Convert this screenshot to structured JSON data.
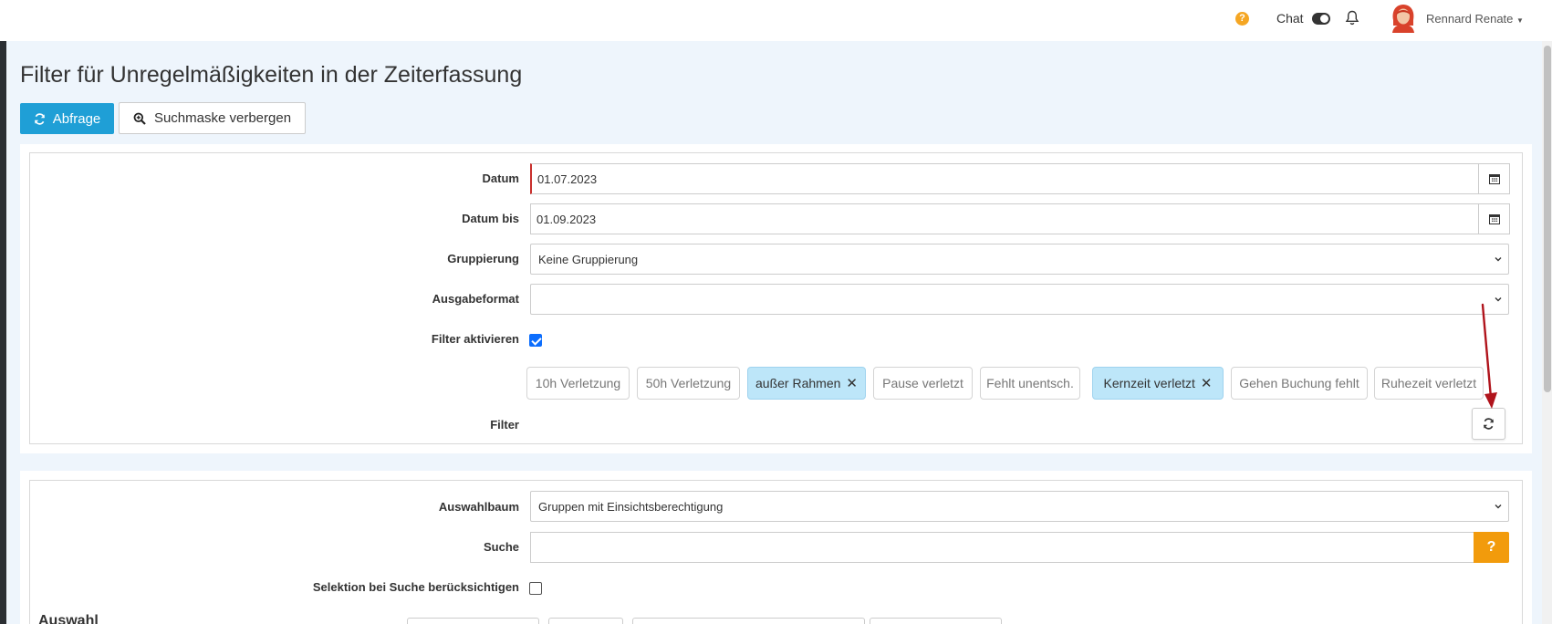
{
  "topbar": {
    "help_label": "?",
    "chat_label": "Chat",
    "user_name": "Rennard Renate"
  },
  "page": {
    "title": "Filter für Unregelmäßigkeiten in der Zeiterfassung"
  },
  "toolbar": {
    "query_label": "Abfrage",
    "hide_search_label": "Suchmaske verbergen"
  },
  "filter_form": {
    "date_label": "Datum",
    "date_value": "01.07.2023",
    "date_to_label": "Datum bis",
    "date_to_value": "01.09.2023",
    "grouping_label": "Gruppierung",
    "grouping_value": "Keine Gruppierung",
    "output_label": "Ausgabeformat",
    "output_value": "",
    "activate_label": "Filter aktivieren",
    "activate_checked": true,
    "filter_label": "Filter",
    "chips": [
      {
        "label": "10h Verletzung",
        "active": false
      },
      {
        "label": "50h Verletzung",
        "active": false
      },
      {
        "label": "außer Rahmen",
        "active": true
      },
      {
        "label": "Pause verletzt",
        "active": false
      },
      {
        "label": "Fehlt unentsch.",
        "active": false
      },
      {
        "label": "Kernzeit verletzt",
        "active": true
      },
      {
        "label": "Gehen Buchung fehlt",
        "active": false
      },
      {
        "label": "Ruhezeit verletzt",
        "active": false
      }
    ],
    "chip_remove_glyph": "✕"
  },
  "selection_form": {
    "tree_label": "Auswahlbaum",
    "tree_value": "Gruppen mit Einsichtsberechtigung",
    "search_label": "Suche",
    "search_value": "",
    "search_help_label": "?",
    "consider_label": "Selektion bei Suche berücksichtigen",
    "consider_checked": false,
    "auswahl_title": "Auswahl"
  },
  "colors": {
    "primary": "#1f9fd6",
    "help_orange": "#f29b0c",
    "chip_active": "#bde6f9",
    "arrow": "#b0141c"
  }
}
